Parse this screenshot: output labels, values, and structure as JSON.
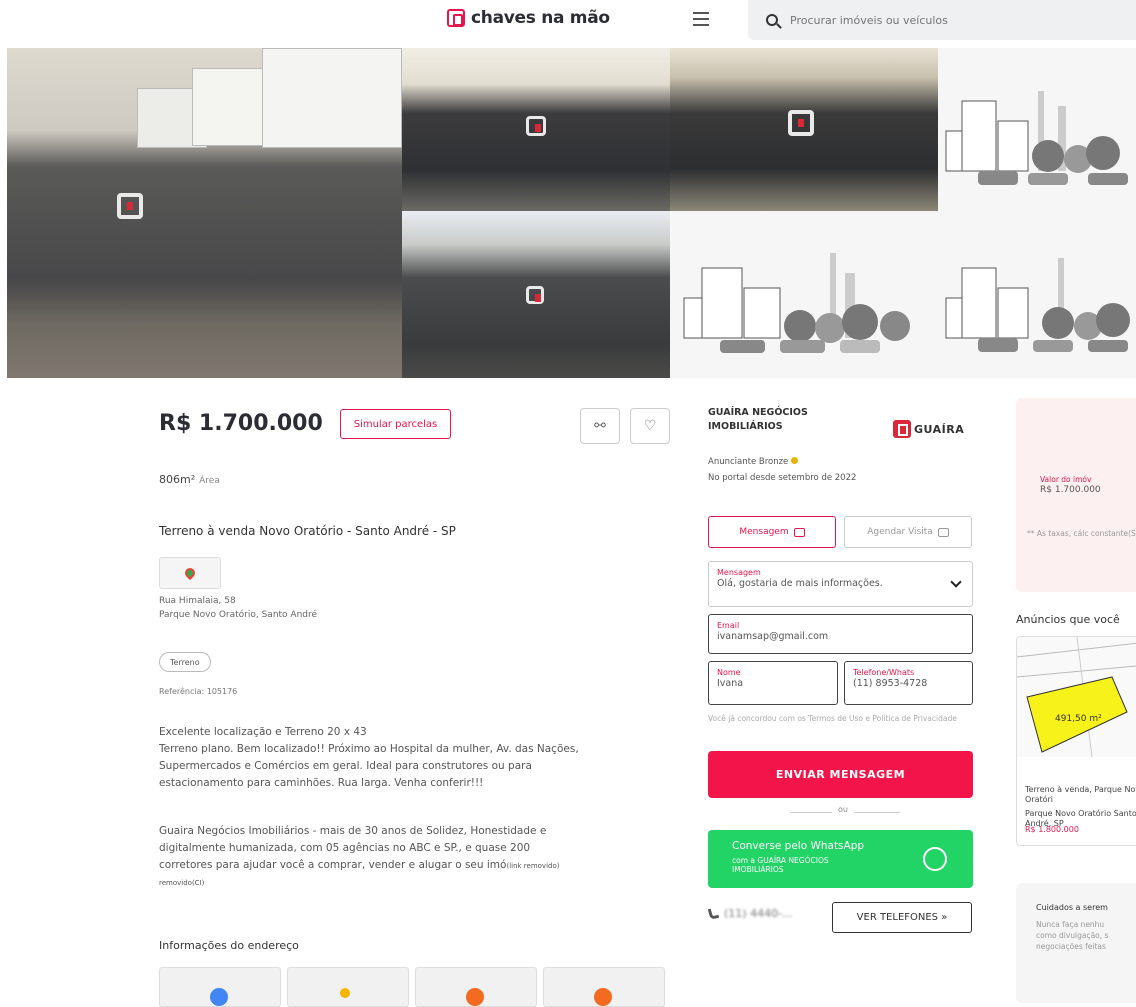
{
  "header": {
    "logo_text": "chaves na mão",
    "search_placeholder": "Procurar imóveis ou veículos"
  },
  "listing": {
    "price": "R$ 1.700.000",
    "simulate_label": "Simular parcelas",
    "area_value": "806m²",
    "area_label": "Área",
    "title": "Terreno à venda Novo Oratório - Santo André - SP",
    "address_line1": "Rua Himalaia, 58",
    "address_line2": "Parque Novo Oratório, Santo André",
    "type_tag": "Terreno",
    "reference": "Referência: 105176",
    "description_1": [
      "Excelente localização e Terreno 20 x 43",
      "Terreno plano. Bem localizado!! Próximo ao Hospital da mulher, Av. das Nações,",
      "Supermercados e Comércios em geral. Ideal para construtores ou para",
      "estacionamento para caminhões. Rua larga. Venha conferir!!!"
    ],
    "description_2": [
      "Guaira Negócios Imobiliários - mais de 30 anos de Solidez, Honestidade e",
      "digitalmente humanizada, com 05 agências no ABC e SP., e quase 200",
      "corretores para ajudar você a comprar, vender e alugar o seu imó"
    ],
    "description_removed": "(link removido)",
    "description_last": "removido(CI)",
    "address_section_title": "Informações do endereço"
  },
  "contact": {
    "agency_name": "GUAÍRA NEGÓCIOS IMOBILIÁRIOS",
    "agency_logo_text": "GUAÍRA",
    "advertiser_level": "Anunciante Bronze",
    "since": "No portal desde setembro de 2022",
    "tab_message": "Mensagem",
    "tab_visit": "Agendar Visita",
    "message_label": "Mensagem",
    "message_value": "Olá, gostaria de mais informações.",
    "email_label": "Email",
    "email_value": "ivanamsap@gmail.com",
    "name_label": "Nome",
    "name_value": "Ivana",
    "phone_label": "Telefone/Whats",
    "phone_value": "(11) 8953-4728",
    "terms": "Você já concordou com os Termos de Uso e Política de Privacidade",
    "send_label": "ENVIAR MENSAGEM",
    "or_label": "ou",
    "whatsapp_main": "Converse pelo WhatsApp",
    "whatsapp_sub": "com a GUAÍRA NEGÓCIOS IMOBILIÁRIOS",
    "phone_partial": "(11) 4440-...",
    "see_phones_label": "VER TELEFONES »"
  },
  "sidebar": {
    "sim_value_label": "Valor do imóv",
    "sim_value": "R$ 1.700.000",
    "sim_note": "** As taxas, cálc constante(SAC) e",
    "ads_title": "Anúncios que você",
    "ad": {
      "map_label": "491,50 m²",
      "title": "Terreno à venda, Parque Novo Oratóri",
      "address": "Parque Novo Oratório Santo André, SP",
      "price": "R$ 1.800.000"
    },
    "care_title": "Cuidados a serem",
    "care_lines": [
      "Nunca faça nenhu",
      "como divulgação, s",
      "negociações feitas"
    ]
  },
  "colors": {
    "accent": "#e4164b",
    "whatsapp": "#22d366"
  }
}
